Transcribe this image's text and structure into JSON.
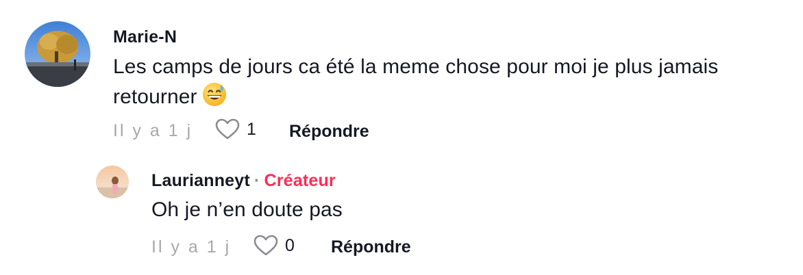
{
  "comments": [
    {
      "username": "Marie-N",
      "text": "Les camps de jours ca été la meme chose pour moi je plus jamais retourner",
      "emoji": "grinning-face-with-sweat",
      "time": "Il y a 1 j",
      "likes": "1",
      "reply_label": "Répondre"
    },
    {
      "username": "Laurianneyt",
      "separator": "·",
      "creator_label": "Créateur",
      "text": "Oh je n’en doute pas",
      "time": "Il y a 1 j",
      "likes": "0",
      "reply_label": "Répondre"
    }
  ],
  "colors": {
    "text": "#161823",
    "muted": "#a7a8ac",
    "creator": "#fe2c55"
  }
}
